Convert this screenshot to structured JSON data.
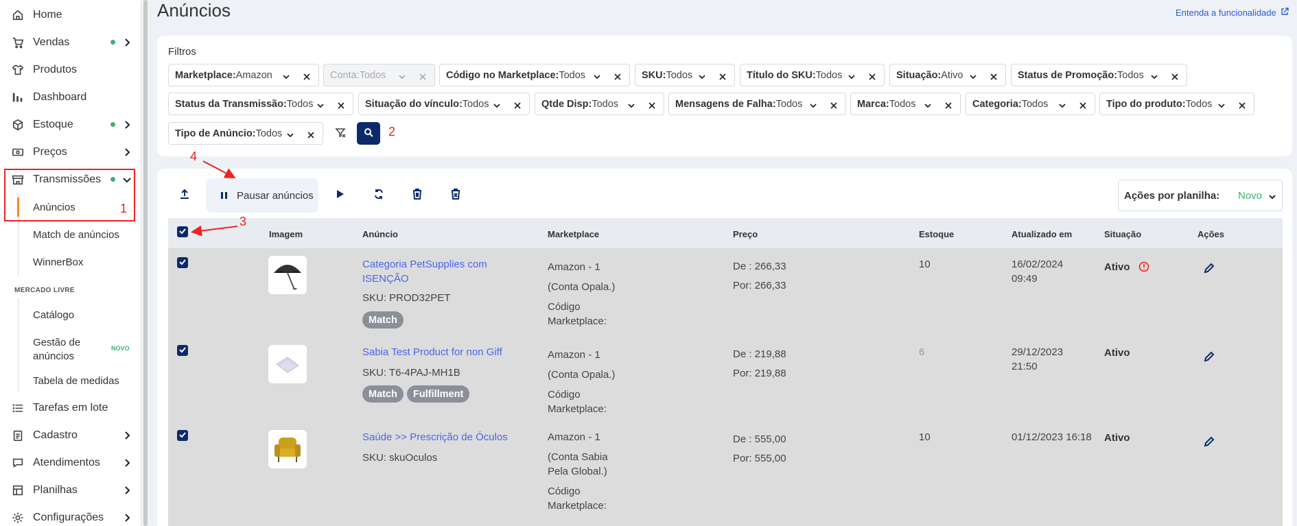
{
  "sidebar": {
    "items": [
      {
        "label": "Home",
        "icon": "home-icon"
      },
      {
        "label": "Vendas",
        "icon": "cart-icon"
      },
      {
        "label": "Produtos",
        "icon": "shirt-icon"
      },
      {
        "label": "Dashboard",
        "icon": "bar-chart-icon"
      },
      {
        "label": "Estoque",
        "icon": "box-icon"
      },
      {
        "label": "Preços",
        "icon": "money-icon"
      },
      {
        "label": "Transmissões",
        "icon": "store-icon"
      },
      {
        "label": "Tarefas em lote",
        "icon": "list-icon"
      },
      {
        "label": "Cadastro",
        "icon": "clipboard-icon"
      },
      {
        "label": "Atendimentos",
        "icon": "chat-icon"
      },
      {
        "label": "Planilhas",
        "icon": "spreadsheet-icon"
      },
      {
        "label": "Configurações",
        "icon": "gear-icon"
      }
    ],
    "transmissoes_sub": [
      "Anúncios",
      "Match de anúncios",
      "WinnerBox"
    ],
    "section_mercado_livre": "MERCADO LIVRE",
    "ml_sub": [
      "Catálogo",
      "Gestão de anúncios",
      "Tabela de medidas"
    ],
    "novo_badge": "NOVO"
  },
  "header": {
    "title": "Anúncios",
    "help_link": "Entenda a funcionalidade"
  },
  "filters": {
    "title": "Filtros",
    "chips": [
      {
        "key": "Marketplace:",
        "value": " Amazon"
      },
      {
        "key": "Conta:",
        "value": " Todos"
      },
      {
        "key": "Código no Marketplace:",
        "value": "Todos"
      },
      {
        "key": "SKU:",
        "value": "Todos"
      },
      {
        "key": "Título do SKU:",
        "value": "Todos"
      },
      {
        "key": "Situação:",
        "value": "Ativo"
      },
      {
        "key": "Status de Promoção:",
        "value": "Todos"
      },
      {
        "key": "Status da Transmissão:",
        "value": "Todos"
      },
      {
        "key": "Situação do vínculo:",
        "value": "Todos"
      },
      {
        "key": "Qtde Disp:",
        "value": "Todos"
      },
      {
        "key": "Mensagens de Falha:",
        "value": " Todos"
      },
      {
        "key": "Marca:",
        "value": "Todos"
      },
      {
        "key": "Categoria:",
        "value": "Todos"
      },
      {
        "key": "Tipo do produto:",
        "value": "Todos"
      },
      {
        "key": "Tipo de Anúncio:",
        "value": "Todos"
      }
    ]
  },
  "toolbar": {
    "pause_label": "Pausar anúncios",
    "acoes_label": "Ações por planilha:",
    "acoes_value": "Novo"
  },
  "table": {
    "headers": [
      "Imagem",
      "Anúncio",
      "Marketplace",
      "Preço",
      "Estoque",
      "Atualizado em",
      "Situação",
      "Ações"
    ],
    "rows": [
      {
        "title_line1": "Categoria PetSupplies com",
        "title_line2": "ISENÇÃO",
        "sku": "SKU: PROD32PET",
        "tags": [
          "Match"
        ],
        "mp_lines": [
          "Amazon - 1",
          "(Conta Opala.)",
          "Código",
          "Marketplace:"
        ],
        "price_de": "De : 266,33",
        "price_por": "Por: 266,33",
        "estoque": "10",
        "updated_line1": "16/02/2024",
        "updated_line2": "09:49",
        "status": "Ativo",
        "image": "umbrella-image"
      },
      {
        "title_line1": "Sabia Test Product for non Giff",
        "title_line2": "",
        "sku": "SKU: T6-4PAJ-MH1B",
        "tags": [
          "Match",
          "Fulfillment"
        ],
        "mp_lines": [
          "Amazon - 1",
          "(Conta Opala.)",
          "Código",
          "Marketplace:"
        ],
        "price_de": "De : 219,88",
        "price_por": "Por: 219,88",
        "estoque": "6",
        "updated_line1": "29/12/2023",
        "updated_line2": "21:50",
        "status": "Ativo",
        "image": "paper-image"
      },
      {
        "title_line1": "Saúde >> Prescrição de Óculos",
        "title_line2": "",
        "sku": "SKU: skuOculos",
        "tags": [],
        "mp_lines": [
          "Amazon - 1",
          "(Conta Sabia",
          "Pela Global.)",
          "Código",
          "Marketplace:"
        ],
        "price_de": "De : 555,00",
        "price_por": "Por: 555,00",
        "estoque": "10",
        "updated_line1": "01/12/2023 16:18",
        "updated_line2": "",
        "status": "Ativo",
        "image": "armchair-image"
      }
    ]
  },
  "annotations": [
    "1",
    "2",
    "3",
    "4"
  ],
  "colors": {
    "primary": "#0c2a6b",
    "link": "#4a66e8",
    "success": "#3cb371",
    "annotation": "#e22222"
  }
}
